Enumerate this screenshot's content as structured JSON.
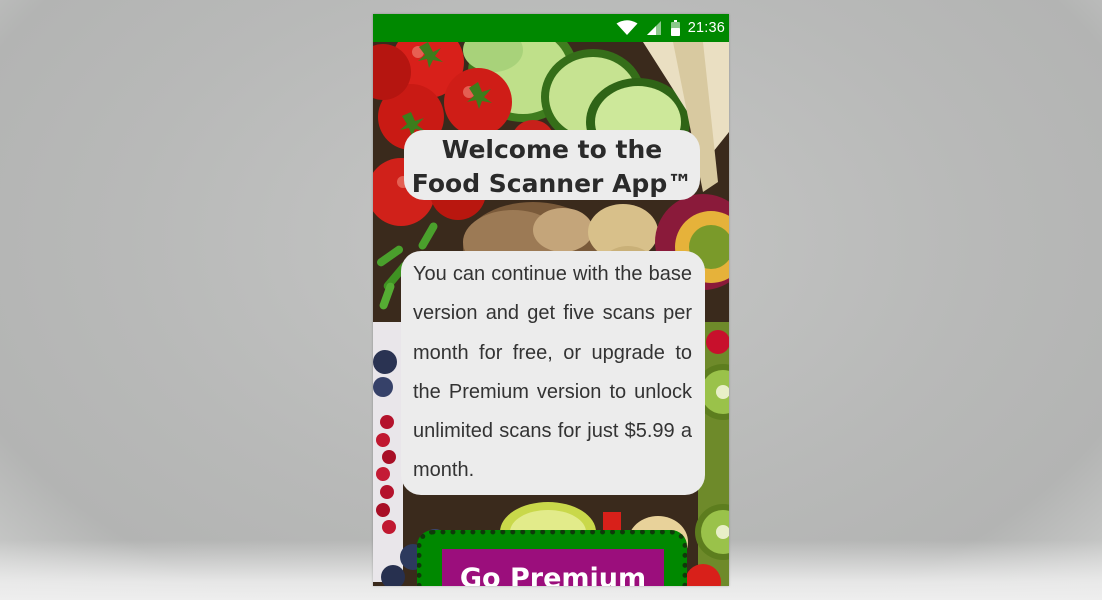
{
  "status_bar": {
    "time": "21:36",
    "icons": [
      "wifi-icon",
      "cellular-signal-icon",
      "battery-icon"
    ],
    "color": "#008800"
  },
  "welcome": {
    "title_line1": "Welcome to the",
    "title_line2": "Food Scanner App™"
  },
  "info": {
    "text": "You can continue with the base version and get five scans per month for free, or upgrade to the Premium version  to unlock unlimited scans for just $5.99 a month."
  },
  "premium": {
    "label": "Go Premium",
    "button_color": "#9b0e7c",
    "frame_color": "#008800"
  },
  "background_image": "fresh fruits and vegetables"
}
